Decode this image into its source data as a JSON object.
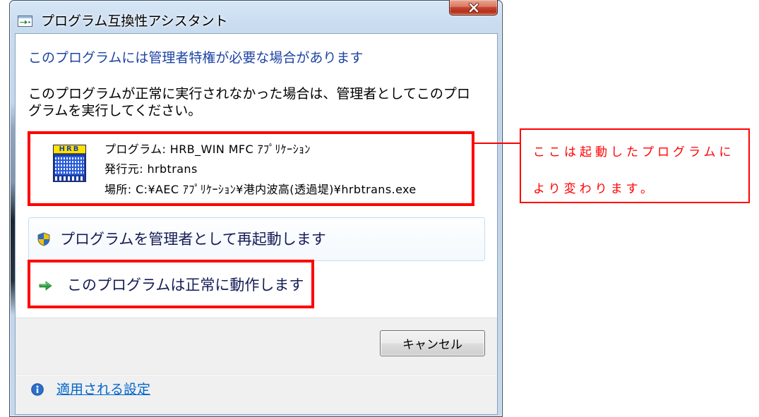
{
  "window": {
    "title": "プログラム互換性アシスタント"
  },
  "main_instruction": "このプログラムには管理者特権が必要な場合があります",
  "content": {
    "lines": [
      "このプログラムが正常に実行されなかった場合は、管理者としてこのプロ",
      "グラムを実行してください。"
    ]
  },
  "program_info": {
    "icon_label": "HRB",
    "program": "プログラム: HRB_WIN MFC ｱﾌﾟﾘｹｰｼｮﾝ",
    "publisher": "発行元: hrbtrans",
    "location": "場所: C:¥AEC ｱﾌﾟﾘｹｰｼｮﾝ¥港内波高(透過堤)¥hrbtrans.exe"
  },
  "command_links": [
    {
      "label": "プログラムを管理者として再起動します"
    },
    {
      "label": "このプログラムは正常に動作します"
    }
  ],
  "footer": {
    "cancel_label": "キャンセル",
    "settings_link": "適用される設定"
  },
  "annotation": {
    "lines": [
      "ここは起動したプログラムに",
      "より変わります。"
    ]
  },
  "icons": {
    "title": "program-compatibility-icon",
    "close": "close-icon",
    "program": "hrb-app-icon",
    "restart": "uac-shield-icon",
    "works": "green-arrow-icon",
    "settings": "info-icon"
  },
  "colors": {
    "main_instruction": "#1e43a3",
    "link": "#0066cc",
    "annotation": "#ff0000",
    "command_link_text": "#151c55",
    "footer_background": "#f0f0f0",
    "close_button": "#c6442e"
  }
}
